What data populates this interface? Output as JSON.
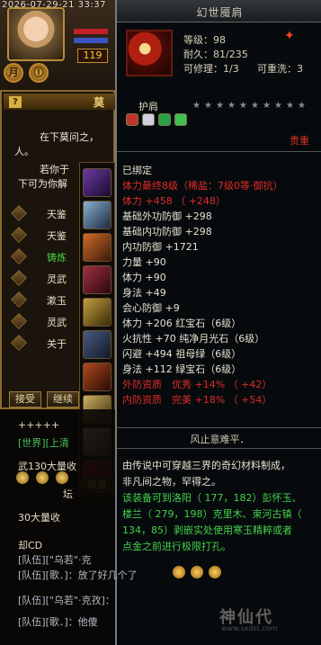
{
  "header": {
    "timestamp": "2026-07-29-21 33:37",
    "level": "119",
    "btn_left": "月",
    "btn_right": "Ⓘ"
  },
  "quest": {
    "title": "莫",
    "lines": [
      "在下莫问之，",
      "人。",
      "若你于",
      "下可为你解"
    ],
    "items": [
      {
        "label": "天鉴",
        "color": "#e8e0c8"
      },
      {
        "label": "天鉴",
        "color": "#e8e0c8"
      },
      {
        "label": "铸炼",
        "color": "#46d04a"
      },
      {
        "label": "灵武",
        "color": "#e8e0c8"
      },
      {
        "label": "漱玉",
        "color": "#e8e0c8"
      },
      {
        "label": "灵武",
        "color": "#e8e0c8"
      },
      {
        "label": "关于",
        "color": "#e8e0c8"
      }
    ],
    "accept": "接受",
    "continue": "继续"
  },
  "chat_left": [
    {
      "text": "+++++",
      "color": "#e0d8c0"
    },
    {
      "text": "[世界][上清",
      "color": "#46c05a"
    },
    {
      "text": "武130大量收",
      "color": "#e0d8c0"
    },
    {
      "text": "坛",
      "color": "#e0d8c0"
    },
    {
      "text": "30大量收",
      "color": "#e0d8c0"
    }
  ],
  "chat_bottom": [
    {
      "text": "却CD",
      "color": "#e0d8c0"
    },
    {
      "text": "[队伍][\"乌若\"·克",
      "color": "#b8b8c8"
    },
    {
      "text": "[队伍][歌．]：放了好几个了",
      "color": "#b8b8c8"
    },
    {
      "text": "[队伍][\"乌若\"·克孜]：",
      "color": "#b8b8c8"
    },
    {
      "text": "[队伍][歌．]：他傻",
      "color": "#b8b8c8"
    }
  ],
  "equip_label": "装备",
  "tooltip": {
    "name": "幻世魇肩",
    "level": "等级：98",
    "durability": "耐久：81/235",
    "repair": "可修理：1/3",
    "rewash": "可重洗：3",
    "type": "护肩",
    "grade": "贵重",
    "attributes": [
      {
        "text": "已绑定",
        "color": "#e8e0d0"
      },
      {
        "text": "体力最终8级（稀盐：7级0等·御抗）",
        "color": "#e02a2a"
      },
      {
        "text": "体力 +458 （ +248）",
        "color": "#e02a2a"
      },
      {
        "text": "基础外功防御 +298",
        "color": "#e8e0d0"
      },
      {
        "text": "基础内功防御 +298",
        "color": "#e8e0d0"
      },
      {
        "text": "内功防御 +1721",
        "color": "#e8e0d0"
      },
      {
        "text": "力量 +90",
        "color": "#e8e0d0"
      },
      {
        "text": "体力 +90",
        "color": "#e8e0d0"
      },
      {
        "text": "身法 +49",
        "color": "#e8e0d0"
      },
      {
        "text": "会心防御 +9",
        "color": "#e8e0d0"
      },
      {
        "text": "体力 +206 红宝石（6级）",
        "color": "#e8e0d0"
      },
      {
        "text": "火抗性 +70 纯净月光石（6级）",
        "color": "#e8e0d0"
      },
      {
        "text": "闪避 +494 祖母绿（6级）",
        "color": "#e8e0d0"
      },
      {
        "text": "身法 +112 绿宝石（6级）",
        "color": "#e8e0d0"
      },
      {
        "text": "外防资质　优秀 +14% （ +42）",
        "color": "#e02a2a"
      },
      {
        "text": "内防资质　完美 +18% （ +54）",
        "color": "#e02a2a"
      }
    ],
    "footer_title": "风止意难平．",
    "description": [
      {
        "text": "由传说中可穿越三界的奇幻材料制成，",
        "color": "#e8e0d0"
      },
      {
        "text": "非凡间之物，罕得之。",
        "color": "#e8e0d0"
      },
      {
        "text": "该装备可到洛阳（ 177，182）彭怀玉、",
        "color": "#46d04a"
      },
      {
        "text": "楼兰（ 279，198）克里木、束河古镇（",
        "color": "#46d04a"
      },
      {
        "text": "134，85）剥嵌实处使用寒玉精粹或者",
        "color": "#46d04a"
      },
      {
        "text": "点金之前进行极限打孔。",
        "color": "#46d04a"
      }
    ]
  },
  "watermark": "神仙代",
  "watermark_url": "www.sxdst.com"
}
